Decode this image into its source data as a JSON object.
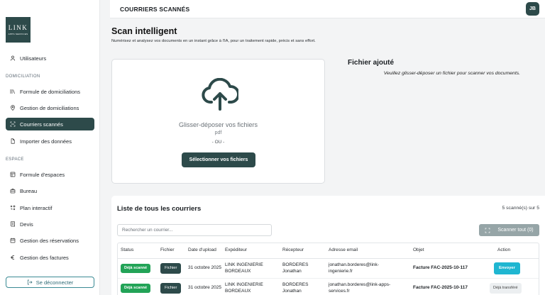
{
  "sidebar": {
    "logo_text": "LINK",
    "logo_sub": "APPS SERVICES",
    "items_top": [
      {
        "label": "Utilisateurs",
        "icon": "user-icon"
      }
    ],
    "section_domiciliation": "DOMICILIATION",
    "items_domiciliation": [
      {
        "label": "Formule de domiciliations",
        "icon": "library-icon"
      },
      {
        "label": "Gestion de domiciliations",
        "icon": "map-pin-icon"
      },
      {
        "label": "Courriers scannés",
        "icon": "scan-icon",
        "active": true
      },
      {
        "label": "Importer des données",
        "icon": "file-icon"
      }
    ],
    "section_espace": "ESPACE",
    "items_espace": [
      {
        "label": "Formule d'espaces",
        "icon": "layout-icon"
      },
      {
        "label": "Bureau",
        "icon": "briefcase-icon"
      },
      {
        "label": "Plan interactif",
        "icon": "plan-icon"
      },
      {
        "label": "Devis",
        "icon": "receipt-icon"
      },
      {
        "label": "Gestion des réservations",
        "icon": "calendar-icon"
      },
      {
        "label": "Gestion des factures",
        "icon": "euro-icon"
      }
    ],
    "logout_label": "Se déconnecter"
  },
  "header": {
    "title": "COURRIERS SCANNÉS",
    "avatar": "JB"
  },
  "page": {
    "title": "Scan intelligent",
    "subtitle": "Numérisez et analysez vos documents en un instant grâce à l'IA, pour un traitement rapide, précis et sans effort."
  },
  "dropzone": {
    "title": "Glisser-déposer vos fichiers",
    "ext": "pdf",
    "or": "- OU -",
    "button": "Sélectionner vos fichiers"
  },
  "added": {
    "title": "Fichier ajouté",
    "note": "Veuillez glisser-déposer un fichier pour scanner vos documents."
  },
  "list": {
    "title": "Liste de tous les courriers",
    "count": "5 scanné(s) sur 5",
    "search_placeholder": "Rechercher un courrier...",
    "scan_all": "Scanner tout (0)",
    "columns": [
      "Status",
      "Fichier",
      "Date d'upload",
      "Expéditeur",
      "Récepteur",
      "Adresse email",
      "Objet",
      "Action"
    ],
    "rows": [
      {
        "status": "Déjà scanné",
        "file": "Fichier",
        "date": "31 octobre 2025",
        "sender": "LINK INGENIERIE BORDEAUX",
        "receiver": "BORDERES Jonathan",
        "email": "jonathan.borderes@link-ingenierie.fr",
        "object": "Facture FAC-2025-10-117",
        "action": "Envoyer",
        "action_type": "send"
      },
      {
        "status": "Déjà scanné",
        "file": "Fichier",
        "date": "31 octobre 2025",
        "sender": "LINK INGENIERIE BORDEAUX",
        "receiver": "BORDERES Jonathan",
        "email": "jonathan.borderes@link-apps-services.fr",
        "object": "Facture FAC-2025-10-117",
        "action": "Déjà transféré",
        "action_type": "done"
      }
    ]
  },
  "colors": {
    "primary": "#2d4a4a",
    "success": "#22a357",
    "send": "#1fb6d1",
    "outline": "#3a8a94"
  }
}
